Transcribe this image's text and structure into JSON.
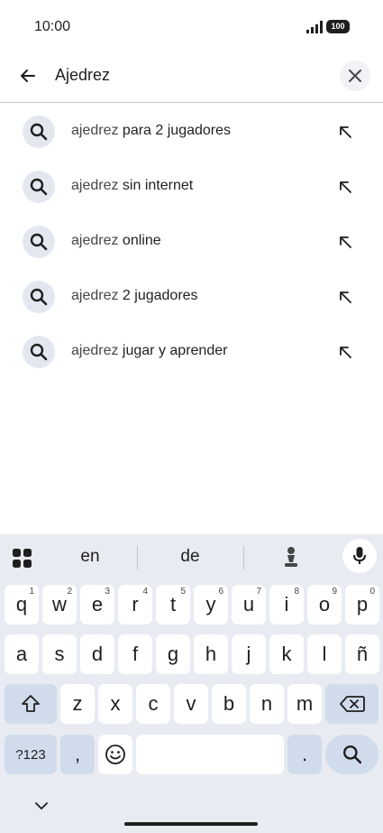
{
  "status": {
    "time": "10:00",
    "battery": "100"
  },
  "search": {
    "query": "Ajedrez",
    "back_icon": "arrow-left-icon",
    "clear_icon": "close-icon"
  },
  "suggestions": [
    {
      "prefix": "ajedrez",
      "rest": " para 2 jugadores"
    },
    {
      "prefix": "ajedrez",
      "rest": " sin internet"
    },
    {
      "prefix": "ajedrez",
      "rest": " online"
    },
    {
      "prefix": "ajedrez",
      "rest": " 2 jugadores"
    },
    {
      "prefix": "ajedrez",
      "rest": " jugar y aprender"
    }
  ],
  "keyboard": {
    "suggestions": [
      "en",
      "de"
    ],
    "row1": [
      {
        "k": "q",
        "s": "1"
      },
      {
        "k": "w",
        "s": "2"
      },
      {
        "k": "e",
        "s": "3"
      },
      {
        "k": "r",
        "s": "4"
      },
      {
        "k": "t",
        "s": "5"
      },
      {
        "k": "y",
        "s": "6"
      },
      {
        "k": "u",
        "s": "7"
      },
      {
        "k": "i",
        "s": "8"
      },
      {
        "k": "o",
        "s": "9"
      },
      {
        "k": "p",
        "s": "0"
      }
    ],
    "row2": [
      "a",
      "s",
      "d",
      "f",
      "g",
      "h",
      "j",
      "k",
      "l",
      "ñ"
    ],
    "row3": [
      "z",
      "x",
      "c",
      "v",
      "b",
      "n",
      "m"
    ],
    "symbols_label": "?123",
    "comma": ",",
    "period": "."
  },
  "colors": {
    "accent_key": "#d0dcec",
    "keyboard_bg": "#e8ebf1",
    "icon_bubble": "#e3e8f0"
  }
}
